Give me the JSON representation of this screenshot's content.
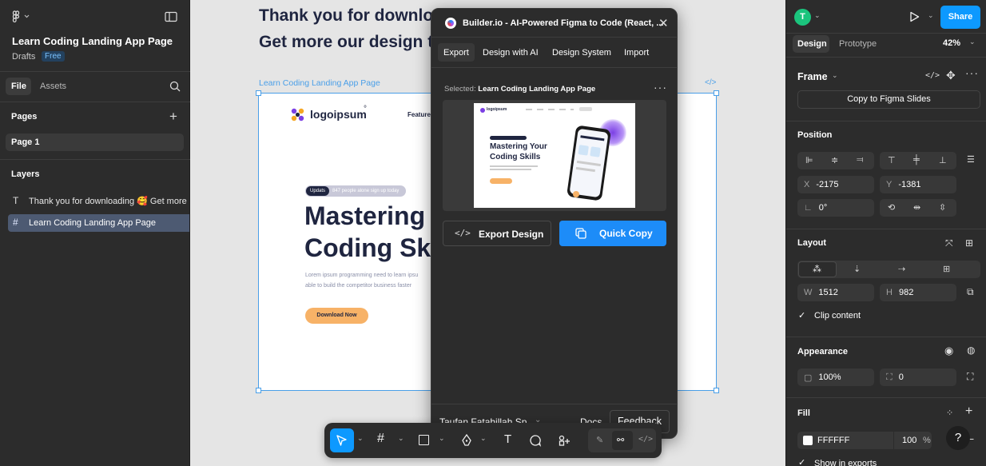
{
  "left_panel": {
    "file_name": "Learn Coding Landing App Page",
    "drafts_label": "Drafts",
    "plan_badge": "Free",
    "tabs": [
      "File",
      "Assets"
    ],
    "pages_title": "Pages",
    "pages": [
      "Page 1"
    ],
    "layers_title": "Layers",
    "layers": [
      {
        "icon": "text-layer-icon",
        "label": "Thank you for downloading 🥰 Get more c"
      },
      {
        "icon": "frame-layer-icon",
        "label": "Learn Coding Landing App Page"
      }
    ]
  },
  "canvas": {
    "heading_line1": "Thank you for download",
    "heading_line2": "Get more our design te",
    "frame_label": "Learn Coding Landing App Page",
    "frame_code_tag": "</>",
    "design": {
      "logo_text": "logoipsum",
      "logo_mark": "°",
      "nav_item": "Features",
      "badge_left": "Updats",
      "badge_right": "847 people alone sign up today",
      "hero_line1": "Mastering",
      "hero_line2": "Coding Ski",
      "body_line1": "Lorem ipsum programming need to learn ipsu",
      "body_line2": "able to build the competitor business faster",
      "cta": "Download Now"
    }
  },
  "plugin": {
    "title": "Builder.io - AI-Powered Figma to Code (React, ...",
    "tabs": [
      "Export",
      "Design with AI",
      "Design System",
      "Import"
    ],
    "active_tab": "Export",
    "selected_label": "Selected:",
    "selected_value": "Learn Coding Landing App Page",
    "preview": {
      "logo_text": "logoipsum",
      "headline_line1": "Mastering Your",
      "headline_line2": "Coding Skills"
    },
    "export_design": "Export Design",
    "quick_copy": "Quick Copy",
    "user": "Taufan Fatahillah Sp...",
    "docs": "Docs",
    "feedback": "Feedback",
    "accent": "#1d8cf8"
  },
  "toolbar": {
    "tools": [
      "move-tool",
      "frame-tool",
      "shape-tool",
      "pen-tool",
      "text-tool",
      "comment-tool",
      "actions-tool"
    ],
    "dev_tools": [
      "draw-mode",
      "design-mode",
      "dev-mode"
    ]
  },
  "right_panel": {
    "avatar_initial": "T",
    "share": "Share",
    "tabs": [
      "Design",
      "Prototype"
    ],
    "zoom": "42%",
    "frame_title": "Frame",
    "copy_slides": "Copy to Figma Slides",
    "position_title": "Position",
    "x_label": "X",
    "x_value": "-2175",
    "y_label": "Y",
    "y_value": "-1381",
    "rotation": "0°",
    "layout_title": "Layout",
    "w_label": "W",
    "w_value": "1512",
    "h_label": "H",
    "h_value": "982",
    "clip_content": "Clip content",
    "appearance_title": "Appearance",
    "opacity": "100%",
    "radius": "0",
    "fill_title": "Fill",
    "fill_hex": "FFFFFF",
    "fill_opacity": "100",
    "fill_pct": "%",
    "show_exports": "Show in exports",
    "help": "?",
    "colors": {
      "share": "#0d99ff",
      "avatar": "#1bc47d",
      "selection": "#4a9fe8"
    }
  }
}
